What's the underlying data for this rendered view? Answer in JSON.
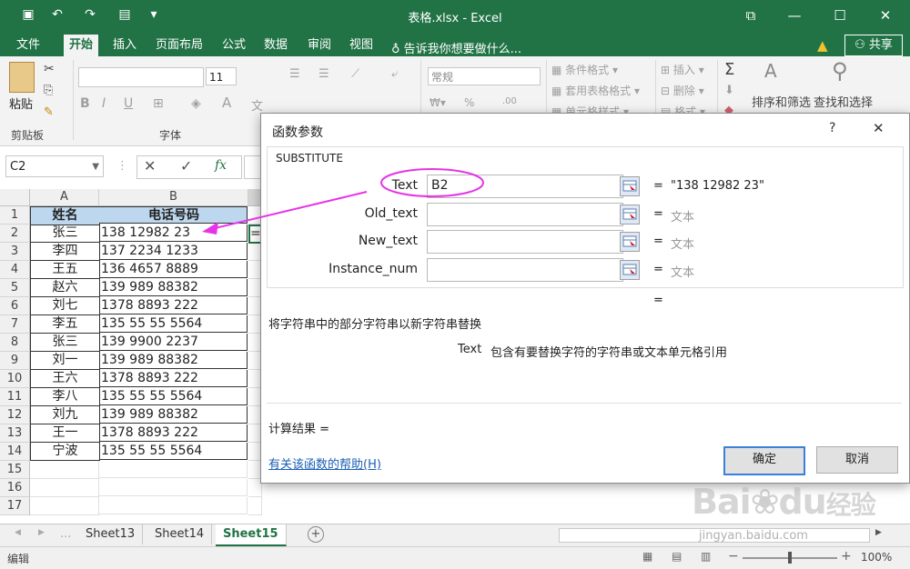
{
  "window": {
    "title": "表格.xlsx - Excel"
  },
  "ribbon_tabs": [
    "文件",
    "开始",
    "插入",
    "页面布局",
    "公式",
    "数据",
    "审阅",
    "视图"
  ],
  "tell_me": "告诉我你想要做什么...",
  "share": "共享",
  "ribbon": {
    "paste": "粘贴",
    "clipboard_group": "剪贴板",
    "font_size": "11",
    "font_group": "字体",
    "number_format": "常规",
    "cond_format": "条件格式",
    "table_format": "套用表格格式",
    "cell_style": "单元格样式",
    "insert": "插入",
    "delete": "删除",
    "format": "格式",
    "sort_filter": "排序和筛选",
    "find_select": "查找和选择",
    "bold": "B",
    "italic": "I",
    "underline": "U",
    "font_color_a": "A",
    "wen": "文",
    "sum": "Σ",
    "sort_glyph": "A",
    "find_glyph": "⚲"
  },
  "formula_bar": {
    "name_box": "C2",
    "fx": "fx",
    "cancel": "✕",
    "enter": "✓"
  },
  "grid": {
    "col_headers": [
      "A",
      "B"
    ],
    "header_row": {
      "a": "姓名",
      "b": "电话号码"
    },
    "rows": [
      {
        "n": "1"
      },
      {
        "n": "2",
        "a": "张三",
        "b": "138  12982 23",
        "c": "="
      },
      {
        "n": "3",
        "a": "李四",
        "b": "137 2234  1233"
      },
      {
        "n": "4",
        "a": "王五",
        "b": "136 4657 8889"
      },
      {
        "n": "5",
        "a": "赵六",
        "b": "139 989 88382"
      },
      {
        "n": "6",
        "a": "刘七",
        "b": "1378   8893 222"
      },
      {
        "n": "7",
        "a": "李五",
        "b": "135 55 55  5564"
      },
      {
        "n": "8",
        "a": "张三",
        "b": "139   9900  2237"
      },
      {
        "n": "9",
        "a": "刘一",
        "b": "139 989 88382"
      },
      {
        "n": "10",
        "a": "王六",
        "b": "1378   8893 222"
      },
      {
        "n": "11",
        "a": "李八",
        "b": "135 55 55  5564"
      },
      {
        "n": "12",
        "a": "刘九",
        "b": "139 989 88382"
      },
      {
        "n": "13",
        "a": "王一",
        "b": "1378   8893 222"
      },
      {
        "n": "14",
        "a": "宁波",
        "b": "135 55 55  5564"
      },
      {
        "n": "15"
      },
      {
        "n": "16"
      },
      {
        "n": "17"
      }
    ]
  },
  "sheets": {
    "tabs": [
      "Sheet13",
      "Sheet14",
      "Sheet15"
    ],
    "active": "Sheet15",
    "add": "+",
    "nav_prev": "◀",
    "nav_next": "▶",
    "ellipsis": "..."
  },
  "status": {
    "mode": "编辑",
    "zoom": "100%",
    "minus": "−",
    "plus": "+"
  },
  "dialog": {
    "title": "函数参数",
    "help_glyph": "?",
    "close_glyph": "✕",
    "function_name": "SUBSTITUTE",
    "args": [
      {
        "label": "Text",
        "value": "B2",
        "result": "\"138  12982 23\""
      },
      {
        "label": "Old_text",
        "value": "",
        "result": "文本"
      },
      {
        "label": "New_text",
        "value": "",
        "result": "文本"
      },
      {
        "label": "Instance_num",
        "value": "",
        "result": "文本"
      }
    ],
    "equals": "=",
    "description": "将字符串中的部分字符串以新字符串替换",
    "arg_desc_name": "Text",
    "arg_desc": "包含有要替换字符的字符串或文本单元格引用",
    "calc_result": "计算结果 =",
    "help_link": "有关该函数的帮助(H)",
    "ok": "确定",
    "cancel": "取消"
  },
  "watermark": {
    "brand": "Bai",
    "brand2": "du",
    "sub": "经验",
    "url": "jingyan.baidu.com"
  },
  "colors": {
    "excel_green": "#217346",
    "annotation": "#e733e7",
    "header_fill": "#bdd7ee"
  }
}
